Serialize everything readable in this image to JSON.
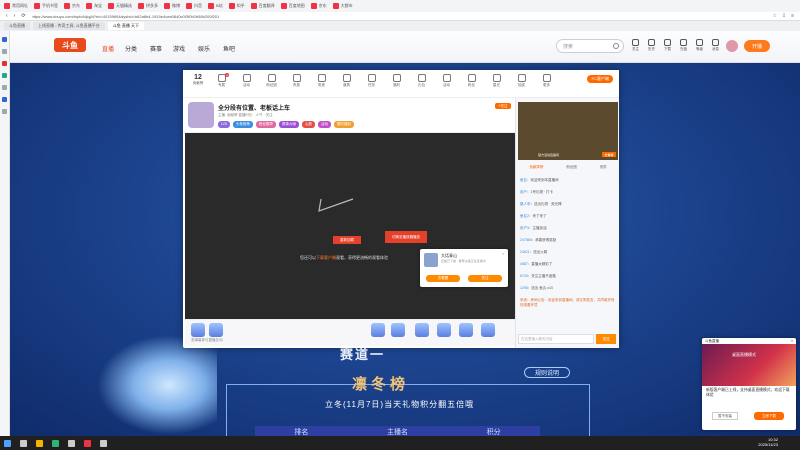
{
  "browser": {
    "bookmarks": [
      "常用网址",
      "手机书签",
      "京东",
      "淘宝",
      "天猫精选",
      "拼多多",
      "微博",
      "抖音",
      "B站",
      "知乎",
      "百度翻译",
      "百度地图",
      "京东",
      "大都市"
    ],
    "url": "https://www.douyu.com/topic/ldjqj4t?rid=4015969&dyshid=b62a8b4-1915e4cea0840c0f3f0b2b58b200f201",
    "tabs": [
      "斗鱼直播",
      "上线直播 - 传奇工具, 斗鱼直播平台",
      "斗鱼 直播 天下"
    ]
  },
  "site": {
    "logo": "斗鱼",
    "nav": [
      "直播",
      "分类",
      "赛事",
      "游戏",
      "娱乐",
      "鱼吧"
    ],
    "search_placeholder": "搜索",
    "header_icons": [
      "关注",
      "历史",
      "下载",
      "充值",
      "等级",
      "消息"
    ],
    "open_live": "开播"
  },
  "modal": {
    "rank_num": "12",
    "rank_label": "贡献榜",
    "icon_labels": [
      "专属",
      "活动",
      "粉丝团",
      "贵族",
      "电竞",
      "道具",
      "任务",
      "福利",
      "礼包",
      "活动",
      "粉丝",
      "星光",
      "抽奖",
      "更多"
    ],
    "pc_client": "PC客户端",
    "stream_title": "全分段有位置、老板话上车",
    "stream_meta": "主播: 贡献榜 直播时长 · 人气 · 关注",
    "tags": [
      "LV5",
      "头条推荐",
      "粉丝徽章",
      "赛事大咖",
      "心愿",
      "活动",
      "限时福利"
    ],
    "follow": "+关注",
    "play_a": "重新加载",
    "play_b": "切换至播放器播放",
    "play_hint_pre": "您还可以",
    "play_hint_hl": "下载客户端",
    "play_hint_post": "观看，获得更流畅的观看体验",
    "popup_name": "大话青山",
    "popup_desc": "直播已下播 · 推荐主播正在直播中",
    "popup_close": "×",
    "popup_btn1": "去看看",
    "popup_btn2": "关注",
    "barrage_placeholder": "发弹幕参与直播互动",
    "right_video_label": "官方活动直播间",
    "right_video_btn": "去看看",
    "right_tabs": [
      "贡献周榜",
      "粉丝团",
      "贵宾"
    ],
    "chat": [
      {
        "user": "鱼友",
        "text": "欢迎来到本直播间"
      },
      {
        "user": "用户",
        "text": "1号礼物 · 打卡"
      },
      {
        "user": "路人甲",
        "text": "送出礼物 · 荧光棒"
      },
      {
        "user": "鱼友2",
        "text": "来了来了"
      },
      {
        "user": "用户3",
        "text": "主播加油"
      },
      {
        "user": "247865",
        "text": "恭喜获得奖励"
      },
      {
        "user": "24621",
        "text": "送出火箭"
      },
      {
        "user": "4587",
        "text": "直播太精彩了"
      },
      {
        "user": "8743",
        "text": "关注主播不迷路"
      },
      {
        "user": "1298",
        "text": "送出 鱼丸 x10"
      },
      {
        "user": "系统",
        "text": "房间公告：欢迎来到直播间，请文明发言，共同维护良好观看环境"
      }
    ],
    "chat_placeholder": "在这里输入聊天内容",
    "send": "发送"
  },
  "page": {
    "section_title": "赛道一",
    "rank_title": "凛冬榜",
    "rules": "规则说明",
    "rank_sub": "立冬(11月7日)当天礼物积分翻五倍哦",
    "rank_head": [
      "排名",
      "主播名",
      "积分"
    ]
  },
  "toast": {
    "head_title": "斗鱼直播",
    "head_close": "×",
    "img_title": "桌面直播模式",
    "text": "新版客户端已上线，支持桌面直播模式，欢迎下载体验",
    "btn1": "暂不安装",
    "btn2": "立即下载"
  },
  "taskbar": {
    "time": "10:32",
    "date": "2025/11/23"
  }
}
